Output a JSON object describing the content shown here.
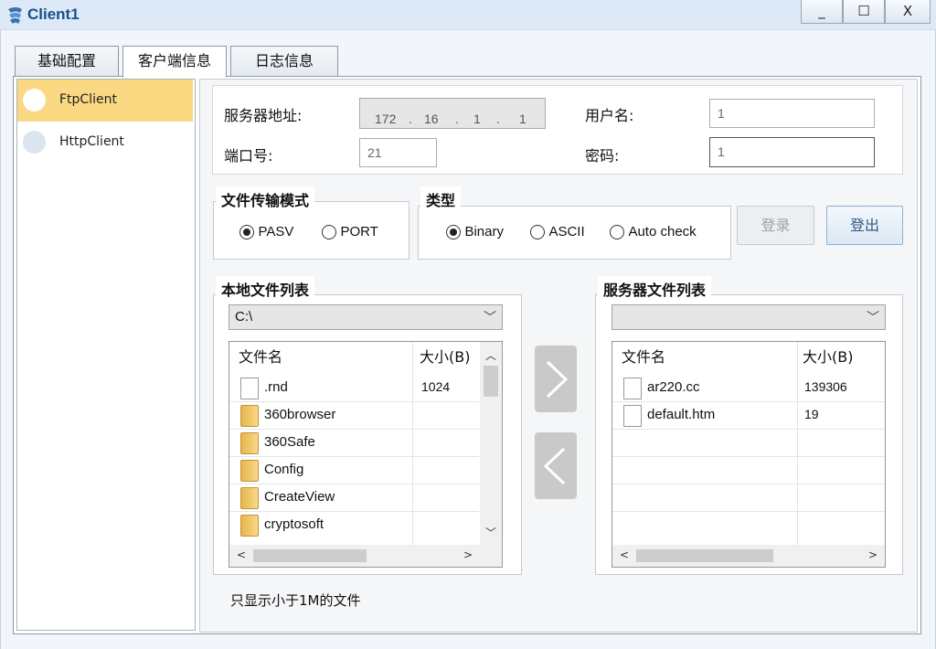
{
  "window": {
    "title": "Client1",
    "controls": {
      "minimize": "_",
      "maximize": "☐",
      "close": "X"
    }
  },
  "tabs": [
    {
      "label": "基础配置",
      "active": false
    },
    {
      "label": "客户端信息",
      "active": true
    },
    {
      "label": "日志信息",
      "active": false
    }
  ],
  "sidebar": {
    "items": [
      {
        "label": "FtpClient",
        "selected": true
      },
      {
        "label": "HttpClient",
        "selected": false
      }
    ]
  },
  "server": {
    "address_label": "服务器地址:",
    "ip": [
      "172",
      "16",
      "1",
      "1"
    ],
    "ip_dot": ".",
    "port_label": "端口号:",
    "port_value": "21",
    "username_label": "用户名:",
    "username_value": "1",
    "password_label": "密码:",
    "password_value": "1"
  },
  "transfer_mode": {
    "title": "文件传输模式",
    "options": [
      {
        "label": "PASV",
        "checked": true
      },
      {
        "label": "PORT",
        "checked": false
      }
    ]
  },
  "type": {
    "title": "类型",
    "options": [
      {
        "label": "Binary",
        "checked": true
      },
      {
        "label": "ASCII",
        "checked": false
      },
      {
        "label": "Auto check",
        "checked": false
      }
    ]
  },
  "buttons": {
    "login": "登录",
    "logout": "登出"
  },
  "local": {
    "title": "本地文件列表",
    "path": "C:\\",
    "col_name": "文件名",
    "col_size": "大小(B)",
    "files": [
      {
        "name": ".rnd",
        "size": "1024",
        "kind": "file"
      },
      {
        "name": "360browser",
        "size": "",
        "kind": "folder"
      },
      {
        "name": "360Safe",
        "size": "",
        "kind": "folder"
      },
      {
        "name": "Config",
        "size": "",
        "kind": "folder"
      },
      {
        "name": "CreateView",
        "size": "",
        "kind": "folder"
      },
      {
        "name": "cryptosoft",
        "size": "",
        "kind": "folder"
      }
    ]
  },
  "remote": {
    "title": "服务器文件列表",
    "path": "",
    "col_name": "文件名",
    "col_size": "大小(B)",
    "files": [
      {
        "name": "ar220.cc",
        "size": "139306",
        "kind": "file"
      },
      {
        "name": "default.htm",
        "size": "19",
        "kind": "file"
      }
    ]
  },
  "note": "只显示小于1M的文件",
  "colors": {
    "selected_item": "#fbd982",
    "accent": "#1a4f8a"
  }
}
